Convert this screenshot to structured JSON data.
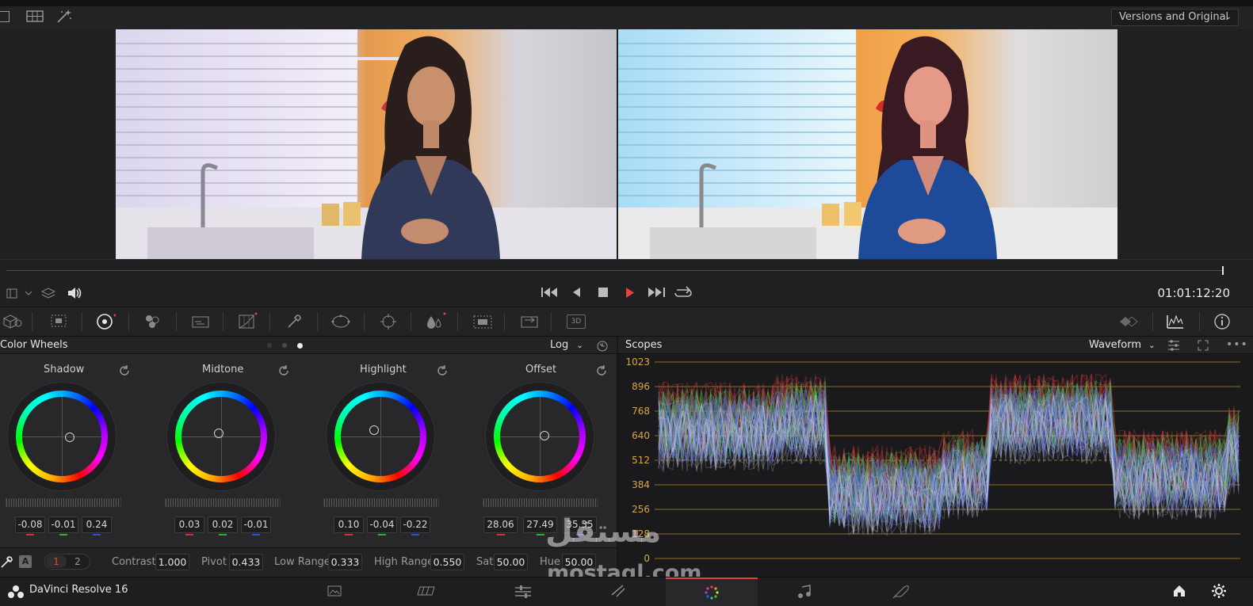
{
  "app": {
    "name": "DaVinci Resolve 16"
  },
  "topbar": {
    "versions_dropdown": "Versions and Original"
  },
  "transport": {
    "timecode": "01:01:12:20"
  },
  "color_wheels": {
    "title": "Color Wheels",
    "mode": "Log",
    "wheels": [
      {
        "name": "Shadow",
        "values": [
          "-0.08",
          "-0.01",
          "0.24"
        ]
      },
      {
        "name": "Midtone",
        "values": [
          "0.03",
          "0.02",
          "-0.01"
        ]
      },
      {
        "name": "Highlight",
        "values": [
          "0.10",
          "-0.04",
          "-0.22"
        ]
      },
      {
        "name": "Offset",
        "values": [
          "28.06",
          "27.49",
          "35.35"
        ]
      }
    ],
    "page_1": "1",
    "page_2": "2",
    "auto_label": "A",
    "params": [
      {
        "label": "Contrast",
        "value": "1.000"
      },
      {
        "label": "Pivot",
        "value": "0.433"
      },
      {
        "label": "Low Range",
        "value": "0.333"
      },
      {
        "label": "High Range",
        "value": "0.550"
      },
      {
        "label": "Sat",
        "value": "50.00"
      },
      {
        "label": "Hue",
        "value": "50.00"
      }
    ]
  },
  "scopes": {
    "title": "Scopes",
    "mode": "Waveform",
    "ticks": [
      "1023",
      "896",
      "768",
      "640",
      "512",
      "384",
      "256",
      "128",
      "0"
    ]
  },
  "watermark": {
    "text": "mostaql.com"
  },
  "colors": {
    "accent_red": "#e0453a",
    "scope_line": "#b38a2e",
    "panel": "#28282a"
  }
}
